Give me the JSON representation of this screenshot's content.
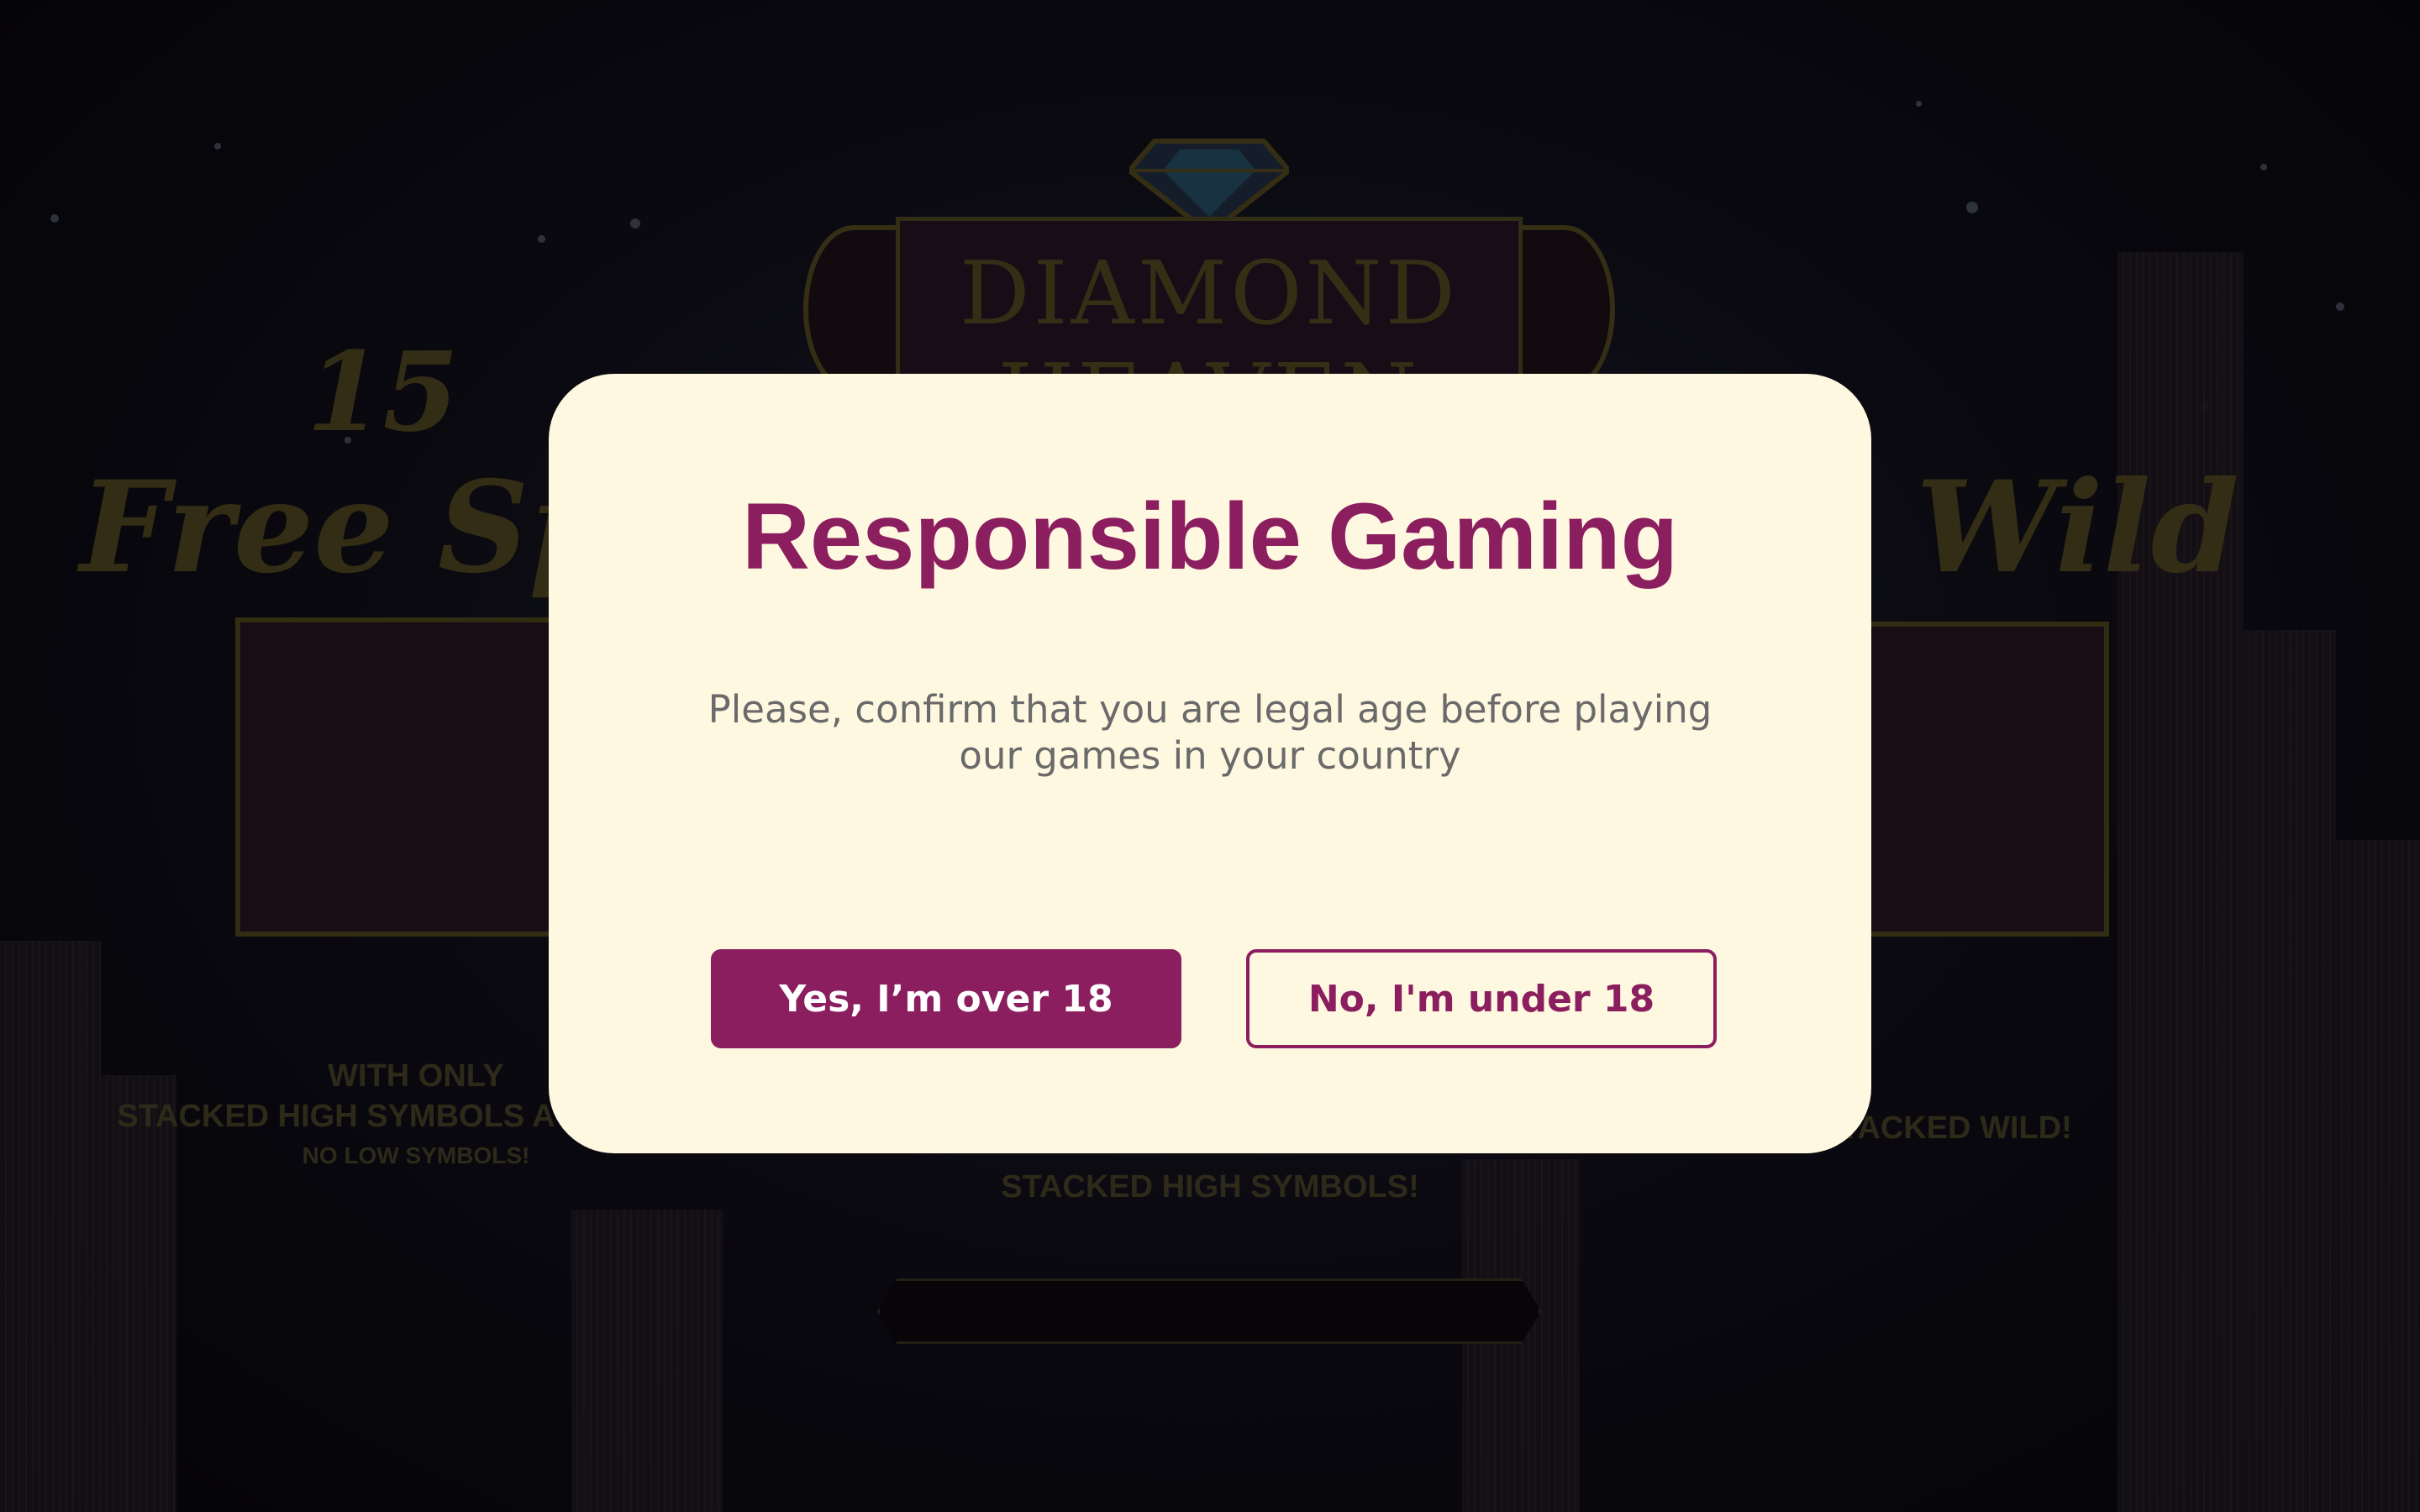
{
  "background": {
    "logo_text": "DIAMOND HEAVEN",
    "left_panel": {
      "title_number": "15",
      "title_text": "Free Sp",
      "caption_line1": "WITH ONLY",
      "caption_line2": "STACKED HIGH SYMBOLS A",
      "caption_line3": "NO LOW SYMBOLS!"
    },
    "right_panel": {
      "title_text": "Wild",
      "caption": "TACKED WILD!"
    },
    "center_caption": "STACKED HIGH SYMBOLS!"
  },
  "modal": {
    "title": "Responsible Gaming",
    "message": "Please, confirm that you are legal age before playing our games in your country",
    "yes_button": "Yes, I’m over 18",
    "no_button": "No, I'm under 18"
  },
  "colors": {
    "accent": "#8b1e5f",
    "modal_background": "#fff8e1",
    "message_text": "#6a6a6a"
  }
}
